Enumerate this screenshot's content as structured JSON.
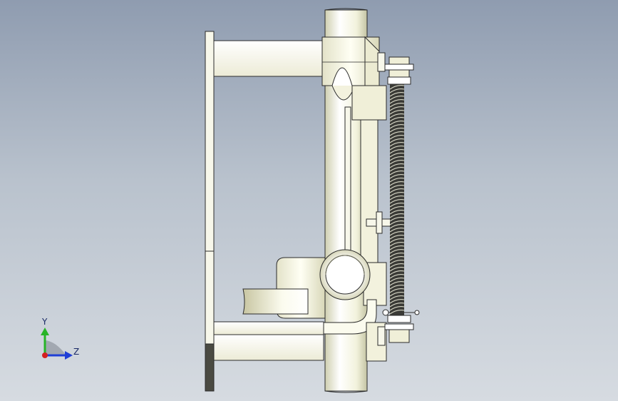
{
  "triad": {
    "y_label": "Y",
    "z_label": "Z",
    "colors": {
      "y": "#27b427",
      "z": "#1f3fd6",
      "origin": "#d42020"
    }
  },
  "colors": {
    "background_top": "#8f9cb0",
    "background_bottom": "#d6dbe1",
    "part_fill": "#f5f5e6",
    "part_edge": "#2b2b2b",
    "spring": "#1b1b1b",
    "dark_plate": "#4a4a42"
  }
}
